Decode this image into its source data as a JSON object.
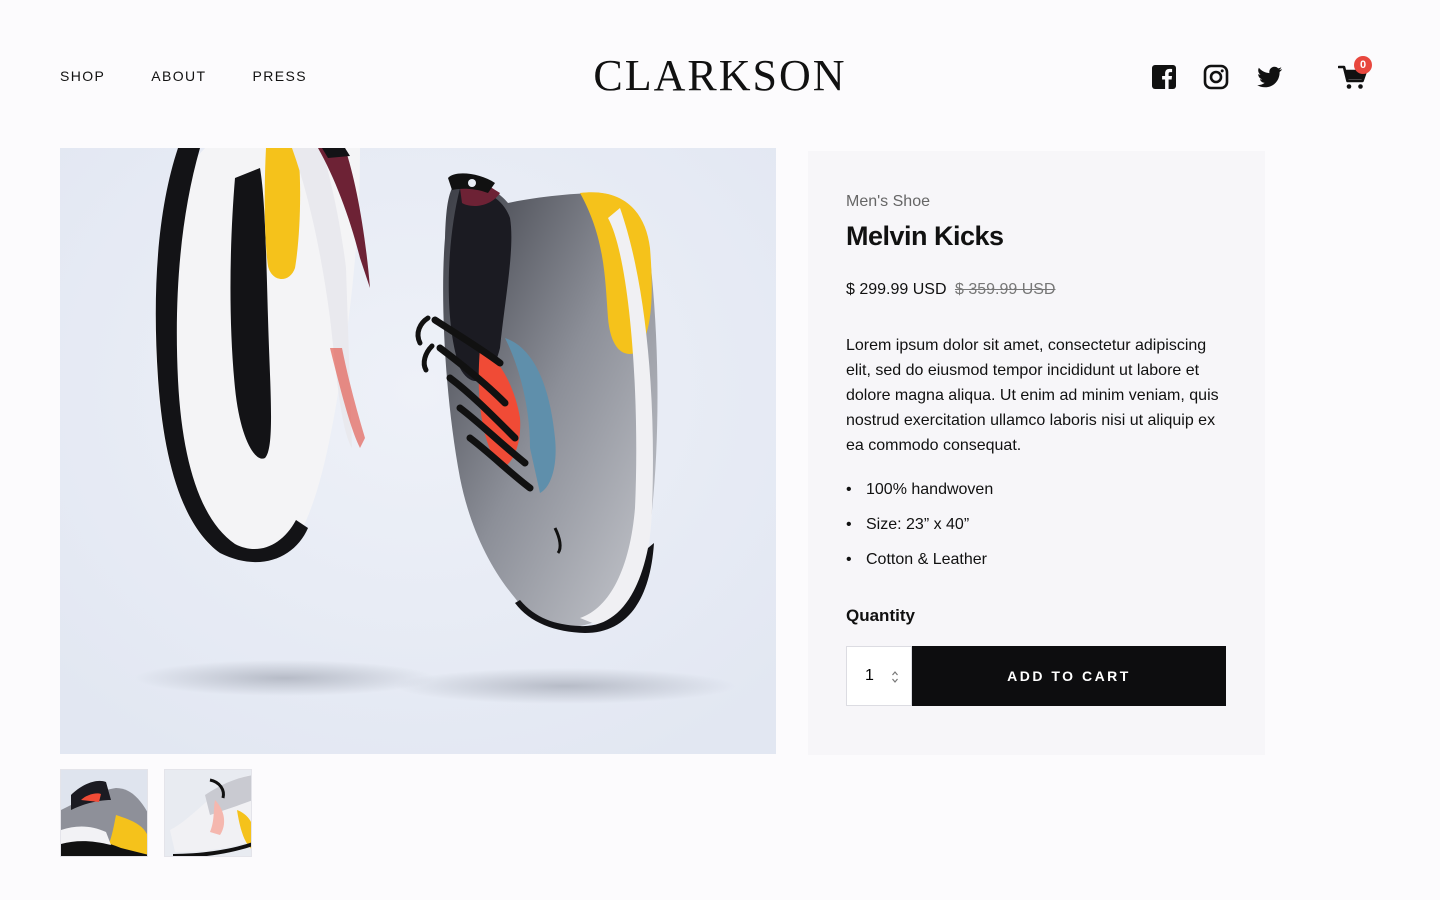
{
  "nav": {
    "items": [
      "SHOP",
      "ABOUT",
      "PRESS"
    ]
  },
  "brand": {
    "logo_text": "CLARKSON"
  },
  "social": {
    "icons": [
      "facebook-icon",
      "instagram-icon",
      "twitter-icon"
    ]
  },
  "cart": {
    "icon": "shopping-cart-icon",
    "count": "0",
    "badge_color": "#e8473e"
  },
  "product": {
    "category": "Men's Shoe",
    "name": "Melvin Kicks",
    "price": "$ 299.99 USD",
    "compare_price": "$ 359.99 USD",
    "description": "Lorem ipsum dolor sit amet, consectetur adipiscing elit, sed do eiusmod tempor incididunt ut labore et dolore magna aliqua. Ut enim ad minim veniam, quis nostrud exercitation ullamco laboris nisi ut aliquip ex ea commodo consequat.",
    "features": [
      "100% handwoven",
      "Size: 23” x 40”",
      "Cotton & Leather"
    ],
    "quantity_label": "Quantity",
    "quantity_value": "1",
    "add_to_cart_label": "ADD TO CART",
    "button_color": "#0d0d0f"
  },
  "colors": {
    "accent_yellow": "#f5c21b",
    "sneaker_red": "#f04b36",
    "background": "#e8edf6"
  }
}
